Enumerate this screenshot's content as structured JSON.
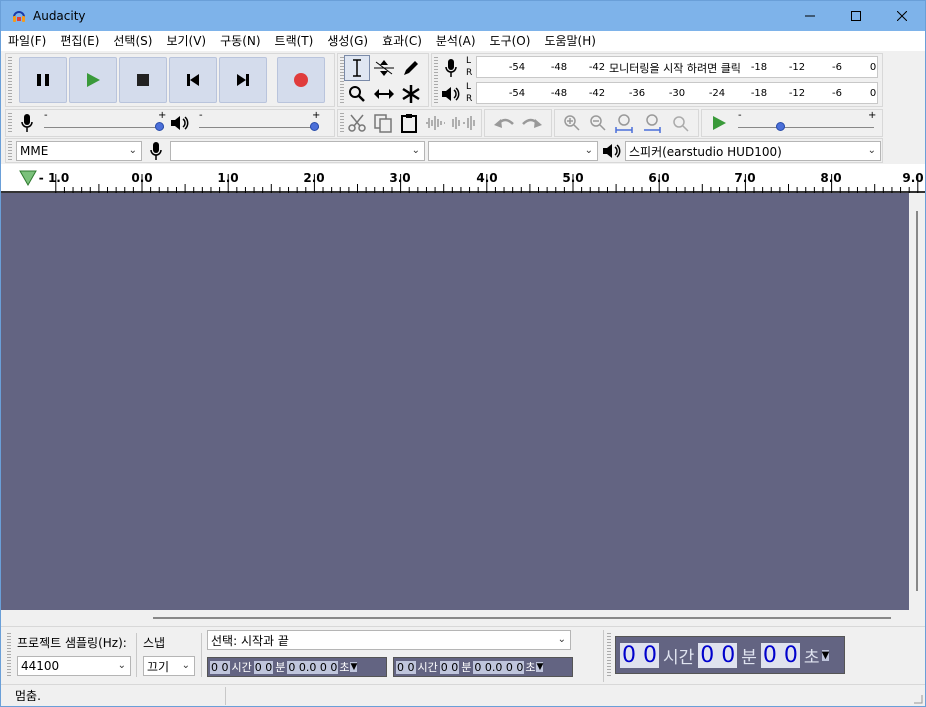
{
  "window": {
    "title": "Audacity"
  },
  "menu": [
    "파일(F)",
    "편집(E)",
    "선택(S)",
    "보기(V)",
    "구동(N)",
    "트랙(T)",
    "생성(G)",
    "효과(C)",
    "분석(A)",
    "도구(O)",
    "도움말(H)"
  ],
  "meter": {
    "record_ticks": [
      "-54",
      "-48",
      "-42",
      "-18",
      "-12",
      "-6",
      "0"
    ],
    "record_hint": "모니터링을 시작 하려면 클릭",
    "play_ticks": [
      "-54",
      "-48",
      "-42",
      "-36",
      "-30",
      "-24",
      "-18",
      "-12",
      "-6",
      "0"
    ],
    "channel_l": "L",
    "channel_r": "R"
  },
  "mixer": {
    "minus": "-",
    "plus": "+",
    "record_volume": 1.0,
    "play_volume": 1.0,
    "play_speed": 0.3
  },
  "device": {
    "host": "MME",
    "recording_device": "",
    "channels": "",
    "playback_device": "스피커(earstudio HUD100)"
  },
  "timeline": {
    "labels": [
      "- 1.0",
      "0.0",
      "1.0",
      "2.0",
      "3.0",
      "4.0",
      "5.0",
      "6.0",
      "7.0",
      "8.0",
      "9.0"
    ]
  },
  "selection": {
    "rate_label": "프로젝트 샘플링(Hz):",
    "rate_value": "44100",
    "snap_label": "스냅",
    "snap_value": "끄기",
    "mode_value": "선택: 시작과 끝",
    "start_time": {
      "h": "0 0",
      "h_unit": "시간",
      "m": "0 0",
      "m_unit": "분",
      "s": "0 0.0 0 0",
      "s_unit": "초"
    },
    "end_time": {
      "h": "0 0",
      "h_unit": "시간",
      "m": "0 0",
      "m_unit": "분",
      "s": "0 0.0 0 0",
      "s_unit": "초"
    }
  },
  "audio_position": {
    "h": "0 0",
    "h_unit": "시간",
    "m": "0 0",
    "m_unit": "분",
    "s": "0 0",
    "s_unit": "초"
  },
  "status": {
    "text": "멈춤."
  },
  "colors": {
    "track_bg": "#636482",
    "record_red": "#e03c3c",
    "play_green": "#3a9a3a",
    "titlebar": "#7eb3ea"
  }
}
